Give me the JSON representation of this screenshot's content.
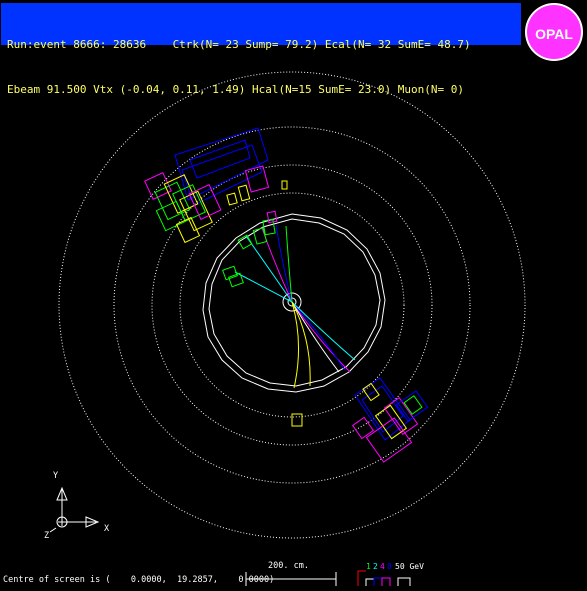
{
  "header": {
    "line1": "Run:event 8666: 28636    Ctrk(N= 23 Sump= 79.2) Ecal(N= 32 SumE= 48.7)",
    "line2": "Ebeam 91.500 Vtx (-0.04, 0.11, 1.49) Hcal(N=15 SumE= 23.0) Muon(N= 0)"
  },
  "logo": {
    "text": "OPAL"
  },
  "axes": {
    "y_label": "Y",
    "x_label": "X",
    "z_label": "Z"
  },
  "scale": {
    "label": "200. cm."
  },
  "energy_legend": {
    "items": [
      {
        "text": "1",
        "color": "#00ff00"
      },
      {
        "text": "2",
        "color": "#00ffff"
      },
      {
        "text": "4",
        "color": "#ff00ff"
      },
      {
        "text": "8",
        "color": "#0000ff"
      },
      {
        "text": "50 GeV",
        "color": "#ffffff"
      }
    ]
  },
  "footer": {
    "centre_text": "Centre of screen is (    0.0000,  19.2857,    0.0000)"
  },
  "colors": {
    "background": "#000000",
    "header_bg": "#0033ff",
    "header_text": "#ffff66",
    "logo_bg": "#ff33ff"
  }
}
